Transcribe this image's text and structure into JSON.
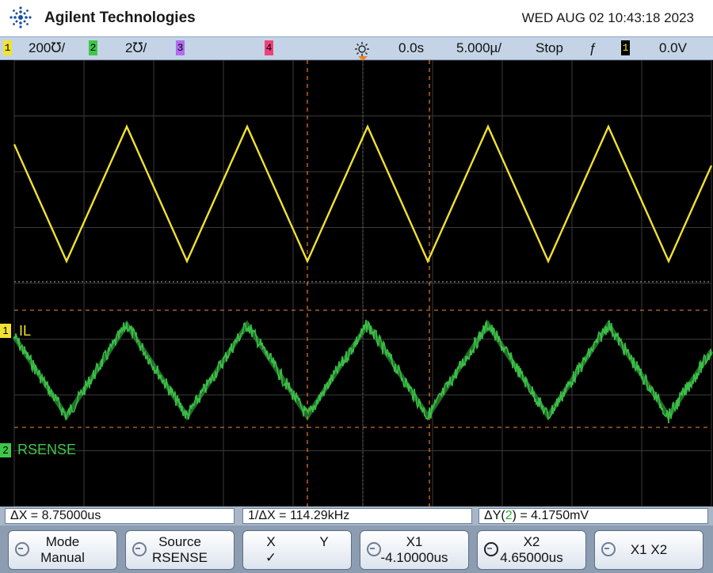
{
  "header": {
    "brand": "Agilent Technologies",
    "datetime": "WED AUG 02 10:43:18 2023",
    "logo_icon": "agilent-spark-icon"
  },
  "status_bar": {
    "ch1_num": "1",
    "ch1_scale": "200℧/",
    "ch2_num": "2",
    "ch2_scale": "2℧/",
    "ch3_num": "3",
    "ch4_num": "4",
    "trigger_icon": "trigger-sun-icon",
    "delay": "0.0s",
    "timebase": "5.000µ/",
    "run_state": "Stop",
    "trig_edge": "ƒ",
    "trig_src": "1",
    "trig_level": "0.0V",
    "colors": {
      "ch1": "#f2e230",
      "ch2": "#3ec84a",
      "ch3": "#b06cf0",
      "ch4": "#f0407a"
    }
  },
  "waveform_labels": {
    "ch1_marker": "1",
    "ch1_label": "IL",
    "ch2_marker": "2",
    "ch2_label": "RSENSE"
  },
  "measurements": {
    "delta_x": "ΔX = 8.75000us",
    "inv_delta_x": "1/ΔX = 114.29kHz",
    "delta_y_prefix": "ΔY(",
    "delta_y_ch": "2",
    "delta_y_suffix": ") = 4.1750mV"
  },
  "softkeys": {
    "mode_label": "Mode",
    "mode_value": "Manual",
    "source_label": "Source",
    "source_value": "RSENSE",
    "x_label": "X",
    "y_label": "Y",
    "xy_check": "✓",
    "x1_label": "X1",
    "x1_value": "-4.10000us",
    "x2_label": "X2",
    "x2_value": "4.65000us",
    "x1x2_label": "X1 X2"
  }
}
